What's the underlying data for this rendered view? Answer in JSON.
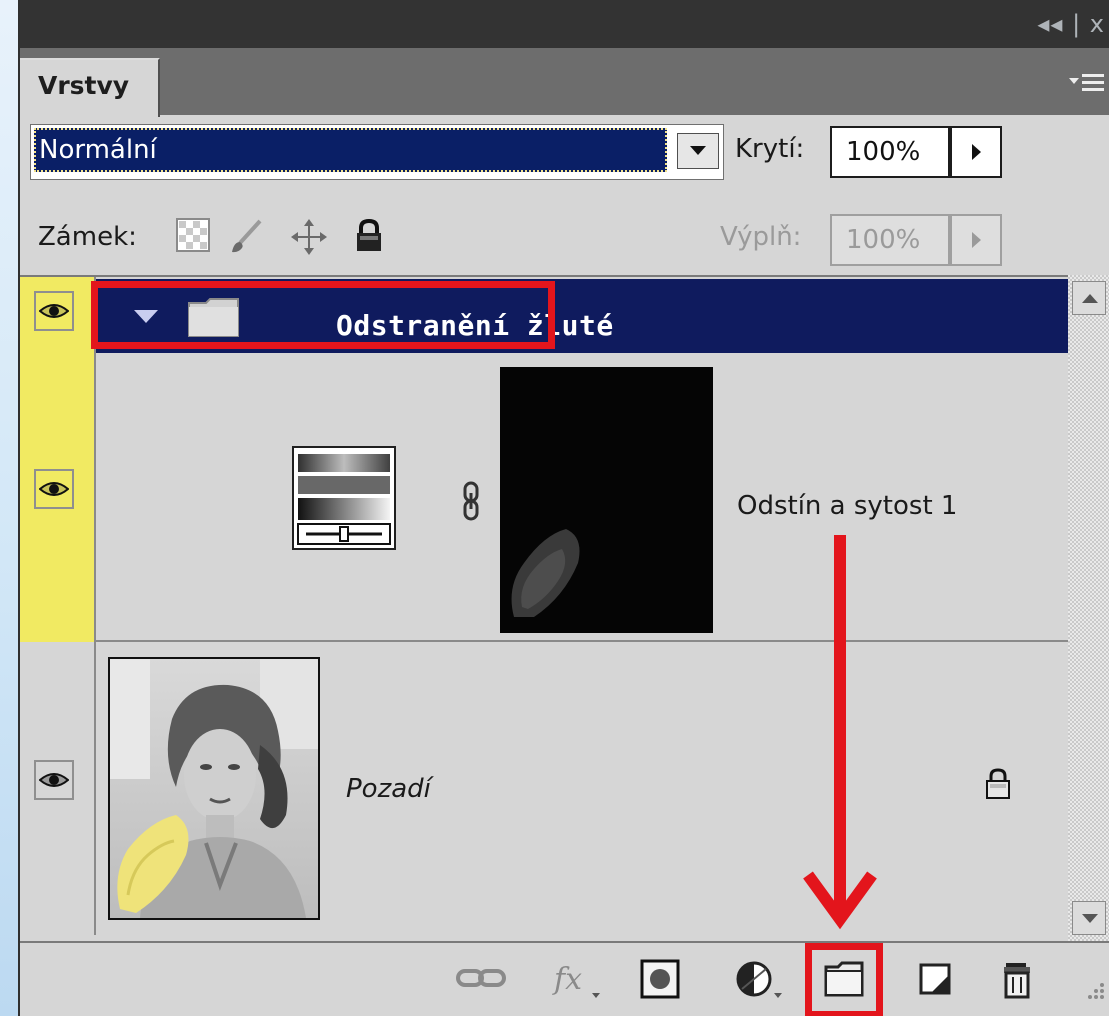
{
  "panel": {
    "tab_label": "Vrstvy",
    "top_controls": "◂◂ | x"
  },
  "blend": {
    "mode": "Normální",
    "opacity_label": "Krytí:",
    "opacity_value": "100%"
  },
  "lock": {
    "label": "Zámek:",
    "fill_label": "Výplň:",
    "fill_value": "100%"
  },
  "layers": {
    "group": {
      "name": "Odstranění žluté",
      "visible": true,
      "expanded": true
    },
    "adjustment": {
      "name": "Odstín a sytost 1",
      "visible": true
    },
    "background": {
      "name": "Pozadí",
      "visible": true,
      "locked": true
    }
  },
  "toolbar": {
    "icons": [
      "link-layers-icon",
      "fx-icon",
      "add-mask-icon",
      "adjustment-layer-icon",
      "new-group-icon",
      "new-layer-icon",
      "trash-icon"
    ],
    "fx_label": "fx"
  },
  "colors": {
    "selection": "#0f1b5e",
    "highlight_red": "#e3151c",
    "group_tag": "#f1ea62",
    "yellow_sleeve": "#efe37a"
  }
}
